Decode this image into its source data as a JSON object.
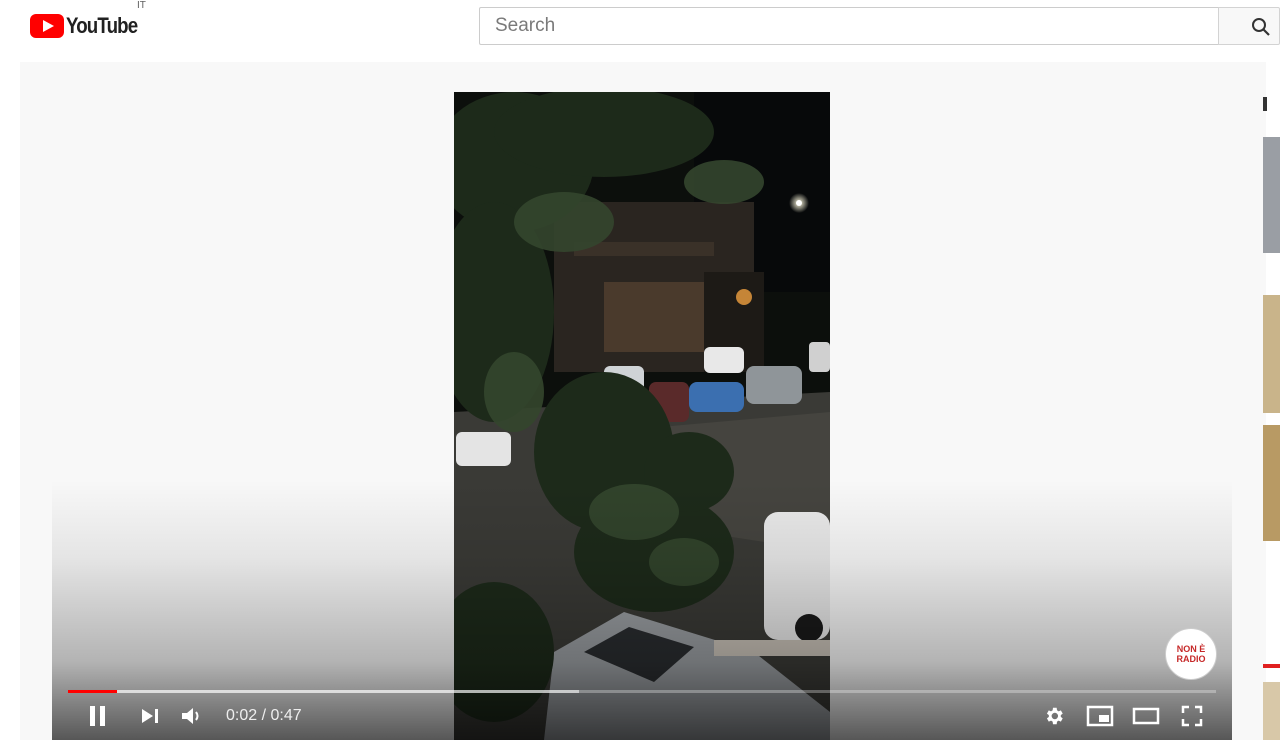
{
  "masthead": {
    "logo_text": "YouTube",
    "country_code": "IT",
    "search_placeholder": "Search",
    "search_value": ""
  },
  "player": {
    "current_time": "0:02",
    "separator": " / ",
    "duration": "0:47",
    "played_fraction": 0.043,
    "buffered_fraction": 0.445,
    "watermark_line1": "NON È",
    "watermark_line2": "RADIO",
    "is_playing": true
  },
  "icons": {
    "logo": "youtube-play-icon",
    "search": "search-icon",
    "pause": "pause-icon",
    "next": "next-icon",
    "volume": "volume-icon",
    "settings": "gear-icon",
    "miniplayer": "miniplayer-icon",
    "theater": "theater-mode-icon",
    "fullscreen": "fullscreen-icon"
  },
  "colors": {
    "brand": "#ff0000",
    "progress_played": "#ff0000",
    "player_background": "#f8f8f8"
  }
}
